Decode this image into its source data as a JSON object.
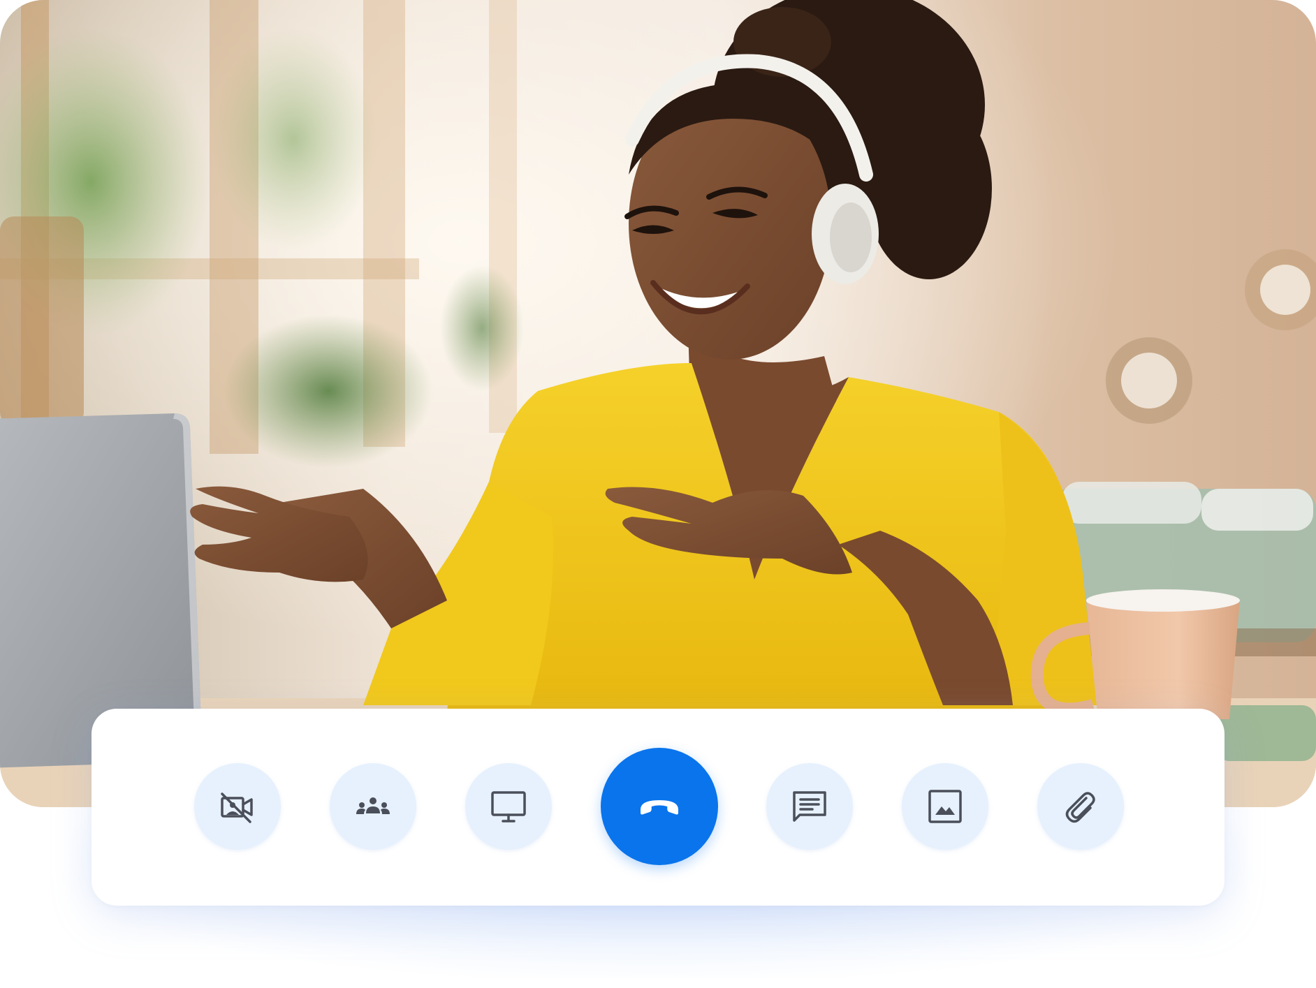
{
  "scene": {
    "photo_subject": "person-on-video-call"
  },
  "call_controls": {
    "items": [
      {
        "icon": "camera-off-icon",
        "action": "toggle-camera"
      },
      {
        "icon": "participants-icon",
        "action": "participants"
      },
      {
        "icon": "screen-share-icon",
        "action": "share-screen"
      },
      {
        "icon": "end-call-icon",
        "action": "end-call"
      },
      {
        "icon": "chat-icon",
        "action": "chat"
      },
      {
        "icon": "image-icon",
        "action": "send-image"
      },
      {
        "icon": "attachment-icon",
        "action": "attach-file"
      }
    ]
  },
  "colors": {
    "accent": "#0a74ec",
    "button_bg": "#e6f1fd",
    "icon": "#4a4f5a",
    "surface": "#ffffff"
  }
}
